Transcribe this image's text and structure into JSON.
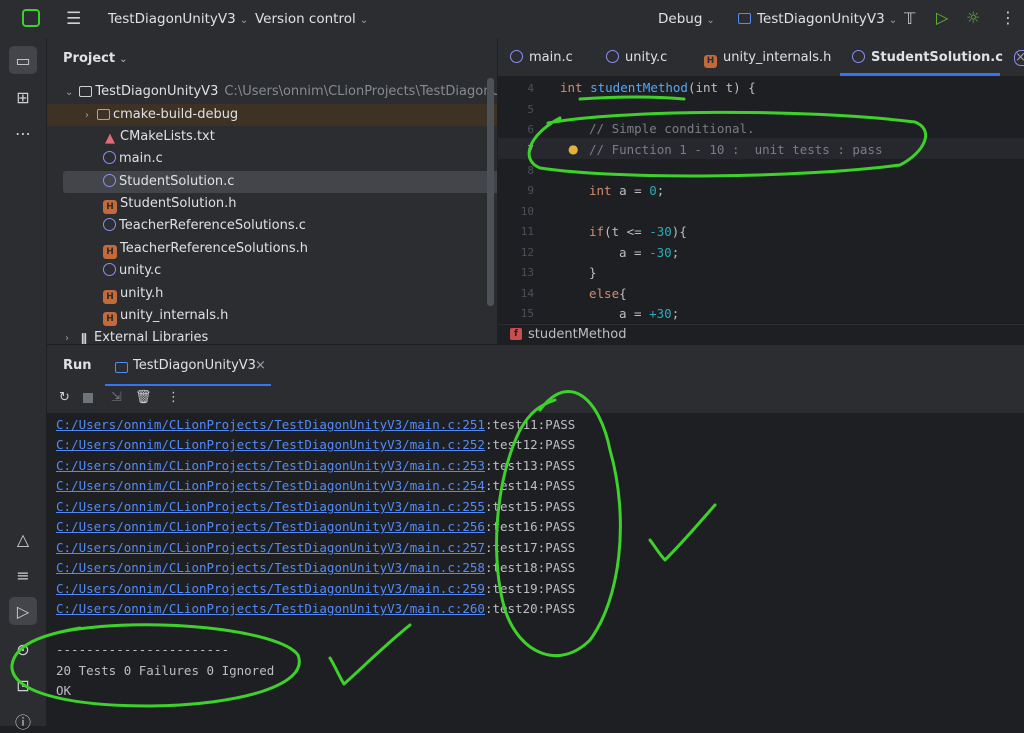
{
  "titlebar": {
    "project_name": "TestDiagonUnityV3",
    "version_control": "Version control",
    "build_config": "Debug",
    "run_target": "TestDiagonUnityV3"
  },
  "project_panel": {
    "title": "Project",
    "root": {
      "name": "TestDiagonUnityV3",
      "path": "C:\\Users\\onnim\\CLionProjects\\TestDiagonUnity"
    },
    "items": [
      {
        "label": "cmake-build-debug",
        "icon": "folder-icon"
      },
      {
        "label": "CMakeLists.txt",
        "icon": "cmake-icon"
      },
      {
        "label": "main.c",
        "icon": "c-file-icon"
      },
      {
        "label": "StudentSolution.c",
        "icon": "c-file-icon"
      },
      {
        "label": "StudentSolution.h",
        "icon": "h-file-icon"
      },
      {
        "label": "TeacherReferenceSolutions.c",
        "icon": "c-file-icon"
      },
      {
        "label": "TeacherReferenceSolutions.h",
        "icon": "h-file-icon"
      },
      {
        "label": "unity.c",
        "icon": "c-file-icon"
      },
      {
        "label": "unity.h",
        "icon": "h-file-icon"
      },
      {
        "label": "unity_internals.h",
        "icon": "h-file-icon"
      }
    ],
    "external_libraries": "External Libraries"
  },
  "editor": {
    "tabs": [
      {
        "label": "main.c",
        "type": "c"
      },
      {
        "label": "unity.c",
        "type": "c"
      },
      {
        "label": "unity_internals.h",
        "type": "h"
      },
      {
        "label": "StudentSolution.c",
        "type": "c"
      }
    ],
    "line_numbers": [
      "4",
      "5",
      "6",
      "7",
      "8",
      "9",
      "10",
      "11",
      "12",
      "13",
      "14",
      "15"
    ],
    "code": {
      "l4_kw": "int ",
      "l4_fn": "studentMethod",
      "l4_rest": "(int t) {",
      "l6": "// Simple conditional.",
      "l7": "// Function 1 - 10 :  unit tests : pass",
      "l9_kw": "int",
      "l9_rest": " a = ",
      "l9_num": "0",
      "l11_kw": "if",
      "l11_rest": "(t <= ",
      "l11_num": "-30",
      "l11_end": "){",
      "l12_rest": "a = ",
      "l12_num": "-30",
      "l13": "}",
      "l14_kw": "else",
      "l14_rest": "{",
      "l15_rest": "a = ",
      "l15_num": "+30"
    },
    "breadcrumb": "studentMethod"
  },
  "run_panel": {
    "title": "Run",
    "tab": "TestDiagonUnityV3",
    "output": [
      {
        "link": "C:/Users/onnim/CLionProjects/TestDiagonUnityV3/main.c:251",
        "text": ":test11:PASS"
      },
      {
        "link": "C:/Users/onnim/CLionProjects/TestDiagonUnityV3/main.c:252",
        "text": ":test12:PASS"
      },
      {
        "link": "C:/Users/onnim/CLionProjects/TestDiagonUnityV3/main.c:253",
        "text": ":test13:PASS"
      },
      {
        "link": "C:/Users/onnim/CLionProjects/TestDiagonUnityV3/main.c:254",
        "text": ":test14:PASS"
      },
      {
        "link": "C:/Users/onnim/CLionProjects/TestDiagonUnityV3/main.c:255",
        "text": ":test15:PASS"
      },
      {
        "link": "C:/Users/onnim/CLionProjects/TestDiagonUnityV3/main.c:256",
        "text": ":test16:PASS"
      },
      {
        "link": "C:/Users/onnim/CLionProjects/TestDiagonUnityV3/main.c:257",
        "text": ":test17:PASS"
      },
      {
        "link": "C:/Users/onnim/CLionProjects/TestDiagonUnityV3/main.c:258",
        "text": ":test18:PASS"
      },
      {
        "link": "C:/Users/onnim/CLionProjects/TestDiagonUnityV3/main.c:259",
        "text": ":test19:PASS"
      },
      {
        "link": "C:/Users/onnim/CLionProjects/TestDiagonUnityV3/main.c:260",
        "text": ":test20:PASS"
      }
    ],
    "separator": "-----------------------",
    "summary": "20 Tests 0 Failures 0 Ignored",
    "result": "OK"
  },
  "colors": {
    "accent": "#3574f0",
    "annotation": "#3fd12b",
    "link": "#548af7"
  }
}
